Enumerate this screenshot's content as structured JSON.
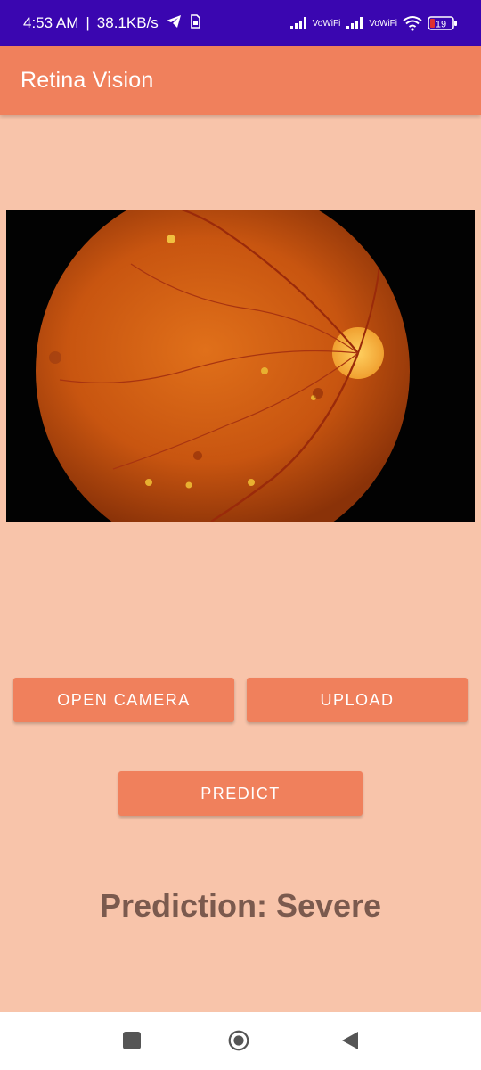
{
  "status_bar": {
    "time": "4:53 AM",
    "separator": "|",
    "net_speed": "38.1KB/s",
    "icons": [
      "telegram-icon",
      "sim-card-icon",
      "signal-icon",
      "vowifi-icon",
      "signal-icon",
      "vowifi-icon",
      "wifi-icon",
      "battery-icon"
    ],
    "vo_label_1": "Vo",
    "wifi_label_1": "WiFi",
    "vo_label_2": "Vo",
    "wifi_label_2": "WiFi",
    "battery_level": "19"
  },
  "app_bar": {
    "title": "Retina Vision"
  },
  "image": {
    "description_icon": "retina-fundus-image"
  },
  "buttons": {
    "open_camera": "OPEN CAMERA",
    "upload": "UPLOAD",
    "predict": "PREDICT"
  },
  "result": {
    "text": "Prediction: Severe"
  },
  "nav": {
    "icons": [
      "recents-square-icon",
      "home-circle-icon",
      "back-triangle-icon"
    ]
  },
  "colors": {
    "status_bar": "#3a06b0",
    "accent": "#f0805c",
    "background": "#f8c4aa",
    "prediction_text": "#7b5a4e"
  }
}
